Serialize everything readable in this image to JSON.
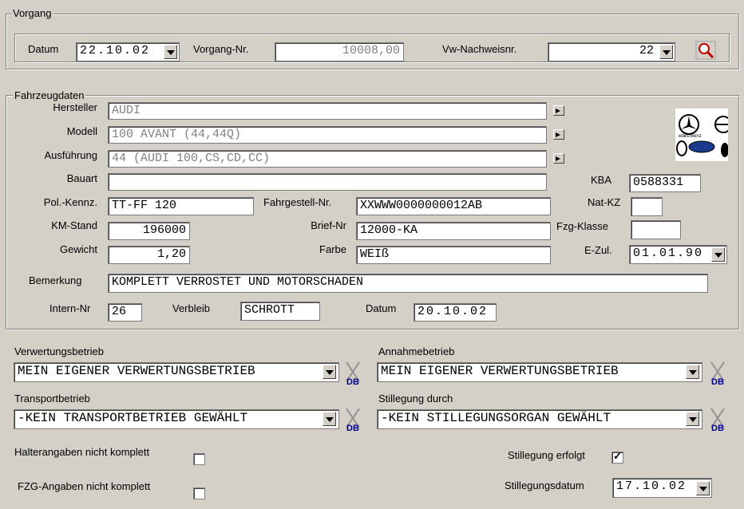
{
  "vorgang": {
    "group_title": "Vorgang",
    "datum_label": "Datum",
    "datum_value": "22.10.02",
    "vorgang_nr_label": "Vorgang-Nr.",
    "vorgang_nr_value": "10008,00",
    "vw_label": "Vw-Nachweisnr.",
    "vw_value": "22"
  },
  "fahrzeug": {
    "group_title": "Fahrzeugdaten",
    "hersteller_label": "Hersteller",
    "hersteller_value": "AUDI",
    "modell_label": "Modell",
    "modell_value": "100 AVANT (44,44Q)",
    "ausfuehrung_label": "Ausführung",
    "ausfuehrung_value": "44 (AUDI 100,CS,CD,CC)",
    "bauart_label": "Bauart",
    "bauart_value": "",
    "kba_label": "KBA",
    "kba_value": "0588331",
    "polkennz_label": "Pol.-Kennz.",
    "polkennz_value": "TT-FF 120",
    "fahrgestell_label": "Fahrgestell-Nr.",
    "fahrgestell_value": "XXWWW0000000012AB",
    "natkz_label": "Nat-KZ",
    "natkz_value": "",
    "kmstand_label": "KM-Stand",
    "kmstand_value": "196000",
    "brief_label": "Brief-Nr",
    "brief_value": "12000-KA",
    "fzgklasse_label": "Fzg-Klasse",
    "fzgklasse_value": "",
    "gewicht_label": "Gewicht",
    "gewicht_value": "1,20",
    "farbe_label": "Farbe",
    "farbe_value": "WEIß",
    "ezul_label": "E-Zul.",
    "ezul_value": "01.01.90",
    "bemerkung_label": "Bemerkung",
    "bemerkung_value": "KOMPLETT VERROSTET UND MOTORSCHADEN",
    "intern_label": "Intern-Nr",
    "intern_value": "26",
    "verbleib_label": "Verbleib",
    "verbleib_value": "SCHROTT",
    "datum_label": "Datum",
    "datum_value": "20.10.02",
    "logo_text": "edes-Benz"
  },
  "betriebe": {
    "verwertung_label": "Verwertungsbetrieb",
    "verwertung_value": "MEIN EIGENER VERWERTUNGSBETRIEB",
    "annahme_label": "Annahmebetrieb",
    "annahme_value": "MEIN EIGENER VERWERTUNGSBETRIEB",
    "transport_label": "Transportbetrieb",
    "transport_value": "-KEIN TRANSPORTBETRIEB GEWÄHLT",
    "stillegung_durch_label": "Stillegung durch",
    "stillegung_durch_value": "-KEIN STILLEGUNGSORGAN GEWÄHLT",
    "db_icon_text": "DB"
  },
  "flags": {
    "halter_label": "Halterangaben nicht komplett",
    "halter_checked": false,
    "fzg_label": "FZG-Angaben nicht komplett",
    "fzg_checked": false,
    "stillegung_erfolgt_label": "Stillegung erfolgt",
    "stillegung_erfolgt_checked": true,
    "stillegungsdatum_label": "Stillegungsdatum",
    "stillegungsdatum_value": "17.10.02"
  }
}
